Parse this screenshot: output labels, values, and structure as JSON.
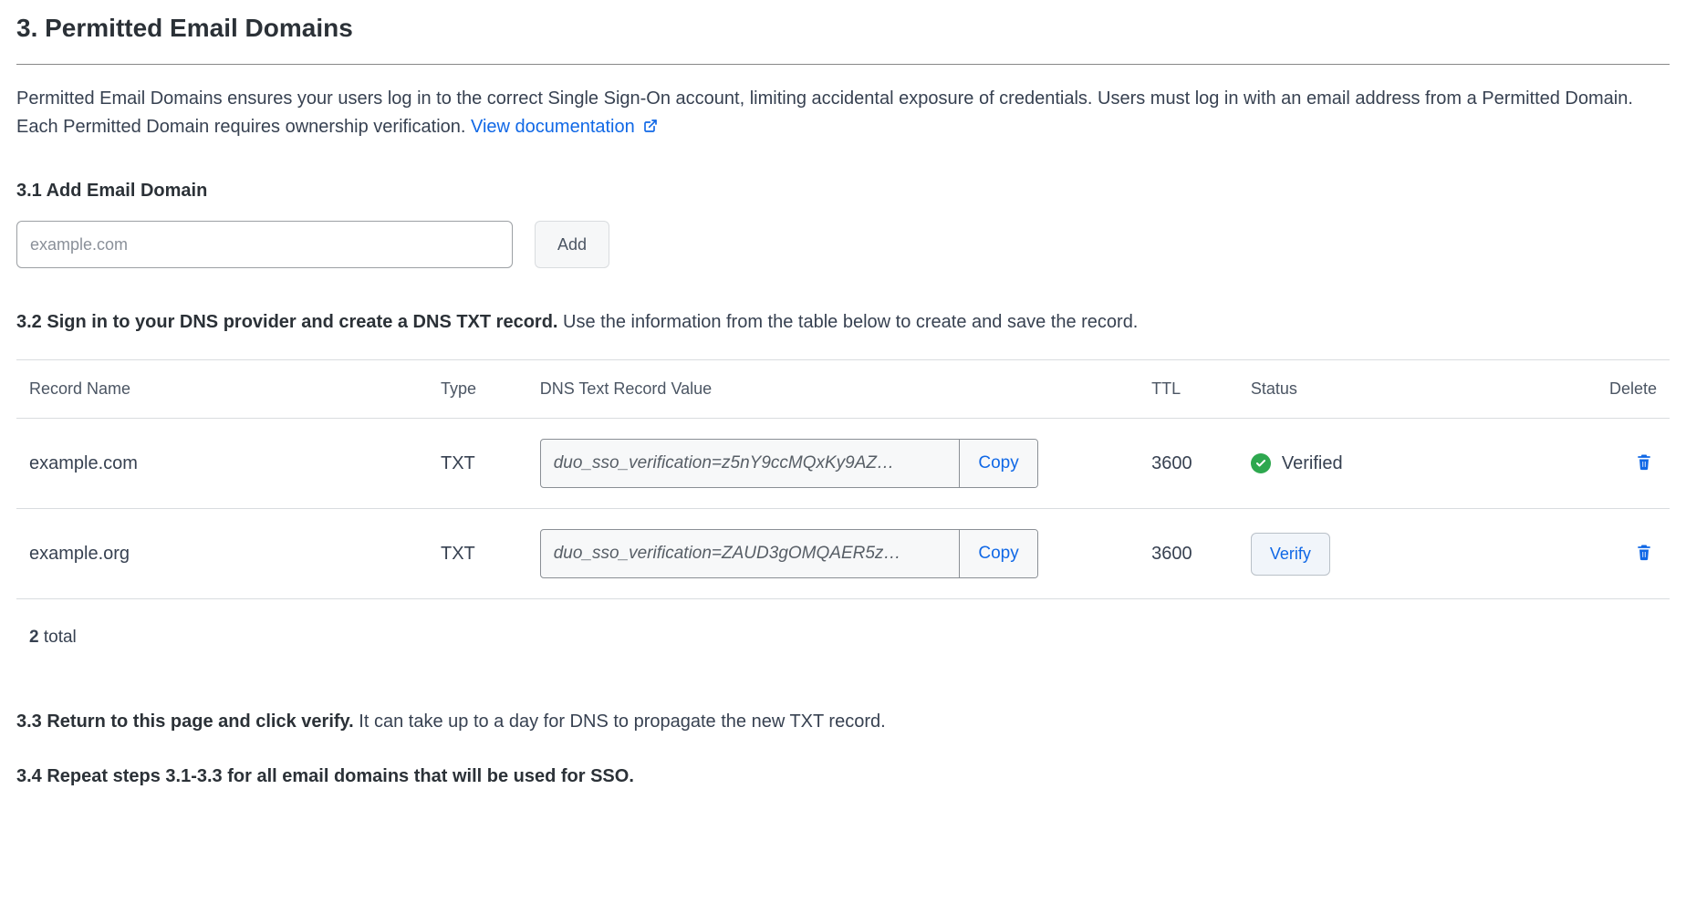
{
  "section": {
    "title": "3. Permitted Email Domains",
    "intro_text": "Permitted Email Domains ensures your users log in to the correct Single Sign-On account, limiting accidental exposure of credentials. Users must log in with an email address from a Permitted Domain. Each Permitted Domain requires ownership verification. ",
    "doc_link_label": "View documentation"
  },
  "step31": {
    "heading": "3.1 Add Email Domain",
    "input_placeholder": "example.com",
    "add_button_label": "Add"
  },
  "step32": {
    "bold": "3.2 Sign in to your DNS provider and create a DNS TXT record.",
    "rest": " Use the information from the table below to create and save the record."
  },
  "table": {
    "headers": {
      "record_name": "Record Name",
      "type": "Type",
      "dns_value": "DNS Text Record Value",
      "ttl": "TTL",
      "status": "Status",
      "delete": "Delete"
    },
    "copy_label": "Copy",
    "verify_label": "Verify",
    "verified_label": "Verified",
    "rows": [
      {
        "record_name": "example.com",
        "type": "TXT",
        "dns_value": "duo_sso_verification=z5nY9ccMQxKy9AZ…",
        "ttl": "3600",
        "verified": true
      },
      {
        "record_name": "example.org",
        "type": "TXT",
        "dns_value": "duo_sso_verification=ZAUD3gOMQAER5z…",
        "ttl": "3600",
        "verified": false
      }
    ],
    "total_count": "2",
    "total_label": " total"
  },
  "step33": {
    "bold": "3.3 Return to this page and click verify.",
    "rest": " It can take up to a day for DNS to propagate the new TXT record."
  },
  "step34": {
    "bold": "3.4 Repeat steps 3.1-3.3 for all email domains that will be used for SSO."
  }
}
